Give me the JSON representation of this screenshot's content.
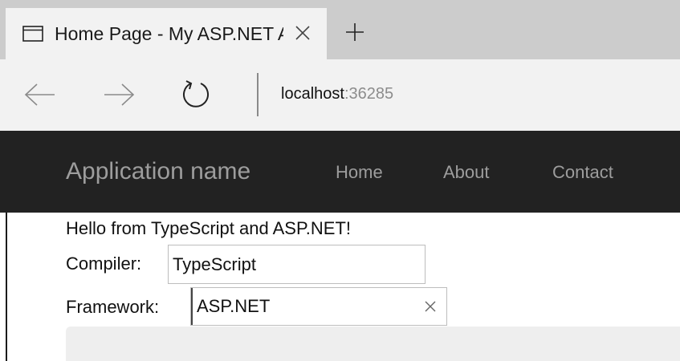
{
  "browser": {
    "tab": {
      "title": "Home Page - My ASP.NET Application",
      "icon": "page-icon",
      "close_icon": "close-icon"
    },
    "new_tab_icon": "plus-icon",
    "nav": {
      "back_icon": "arrow-left-icon",
      "forward_icon": "arrow-right-icon",
      "refresh_icon": "refresh-icon"
    },
    "address": {
      "host": "localhost",
      "port": ":36285"
    }
  },
  "site": {
    "brand": "Application name",
    "nav_items": [
      {
        "label": "Home"
      },
      {
        "label": "About"
      },
      {
        "label": "Contact"
      }
    ],
    "colors": {
      "navbar_bg": "#222222",
      "navbar_text": "#9d9d9d"
    }
  },
  "content": {
    "greeting": "Hello from TypeScript and ASP.NET!",
    "compiler": {
      "label": "Compiler:",
      "value": "TypeScript"
    },
    "framework": {
      "label": "Framework:",
      "value": "ASP.NET",
      "clear_icon": "clear-icon"
    }
  }
}
